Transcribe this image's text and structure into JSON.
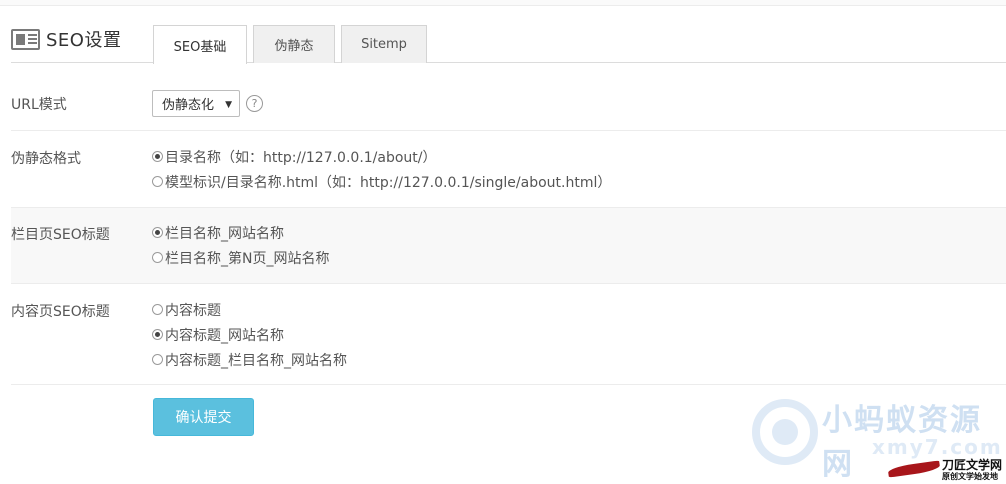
{
  "page": {
    "title": "SEO设置",
    "title_icon": "news-icon"
  },
  "tabs": [
    {
      "label": "SEO基础",
      "active": true
    },
    {
      "label": "伪静态",
      "active": false
    },
    {
      "label": "Sitemp",
      "active": false
    }
  ],
  "url_mode": {
    "label": "URL模式",
    "selected": "伪静态化",
    "help_icon": "question-circle-icon",
    "help_glyph": "?"
  },
  "static_format": {
    "label": "伪静态格式",
    "options": [
      {
        "text": "目录名称（如：http://127.0.0.1/about/）",
        "checked": true
      },
      {
        "text": "模型标识/目录名称.html（如：http://127.0.0.1/single/about.html）",
        "checked": false
      }
    ]
  },
  "column_title": {
    "label": "栏目页SEO标题",
    "options": [
      {
        "text": "栏目名称_网站名称",
        "checked": true
      },
      {
        "text": "栏目名称_第N页_网站名称",
        "checked": false
      }
    ]
  },
  "content_title": {
    "label": "内容页SEO标题",
    "options": [
      {
        "text": "内容标题",
        "checked": false
      },
      {
        "text": "内容标题_网站名称",
        "checked": true
      },
      {
        "text": "内容标题_栏目名称_网站名称",
        "checked": false
      }
    ]
  },
  "submit": {
    "label": "确认提交"
  },
  "colors": {
    "submit_bg": "#5bc0de",
    "text": "#555555"
  },
  "watermarks": {
    "site_name": "小蚂蚁资源网",
    "site_url": "xmy7.com",
    "brand_name": "刀匠文学网",
    "brand_slogan": "原创文学始发地"
  }
}
